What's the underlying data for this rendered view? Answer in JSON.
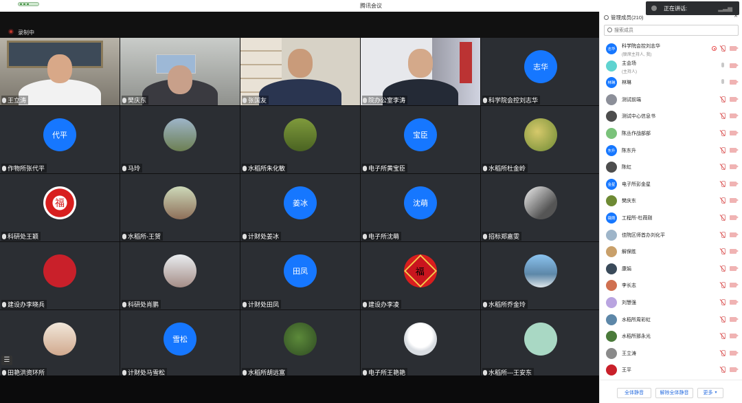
{
  "window": {
    "title": "腾讯会议"
  },
  "speaking_indicator": {
    "label": "正在讲话:"
  },
  "recording": {
    "label": "录制中"
  },
  "grid_menu_icon": "menu-icon",
  "tiles": [
    {
      "name": "王立涛",
      "kind": "video"
    },
    {
      "name": "樊庆东",
      "kind": "video"
    },
    {
      "name": "张国友",
      "kind": "video"
    },
    {
      "name": "院办公室李涛",
      "kind": "video"
    },
    {
      "name": "科学院会控刘志华",
      "kind": "avatar",
      "avatar_text": "志华"
    },
    {
      "name": "作物所张代平",
      "kind": "avatar",
      "avatar_text": "代平"
    },
    {
      "name": "马玲",
      "kind": "image"
    },
    {
      "name": "水稻所朱化敏",
      "kind": "image"
    },
    {
      "name": "电子所黄宝臣",
      "kind": "avatar",
      "avatar_text": "宝臣"
    },
    {
      "name": "水稻所杜金岭",
      "kind": "image"
    },
    {
      "name": "科研处王颖",
      "kind": "image",
      "avatar_text": "福"
    },
    {
      "name": "水稻所-王贺",
      "kind": "image"
    },
    {
      "name": "计财处姜冰",
      "kind": "avatar",
      "avatar_text": "姜冰"
    },
    {
      "name": "电子所沈萌",
      "kind": "avatar",
      "avatar_text": "沈萌"
    },
    {
      "name": "招标郑嘉雯",
      "kind": "image"
    },
    {
      "name": "建设办李晓兵",
      "kind": "image"
    },
    {
      "name": "科研处肖鹏",
      "kind": "image"
    },
    {
      "name": "计财处田凤",
      "kind": "avatar",
      "avatar_text": "田凤"
    },
    {
      "name": "建设办李凌",
      "kind": "image",
      "avatar_text": "福"
    },
    {
      "name": "水稻所乔金玲",
      "kind": "image"
    },
    {
      "name": "田艳洪资环所",
      "kind": "image"
    },
    {
      "name": "计财处马雪松",
      "kind": "avatar",
      "avatar_text": "雪松"
    },
    {
      "name": "水稻所胡远富",
      "kind": "image"
    },
    {
      "name": "电子所王艳艳",
      "kind": "image"
    },
    {
      "name": "水稻所---王安东",
      "kind": "image"
    }
  ],
  "panel": {
    "title": "管理成员(210)",
    "search_placeholder": "搜索成员",
    "members": [
      {
        "name": "科学院会控刘志华",
        "role": "(联席主持人, 我)",
        "avatar_text": "志华",
        "color": "#1677ff",
        "mic": "muted",
        "recording": true
      },
      {
        "name": "主会场",
        "role": "(主持人)",
        "avatar_text": "",
        "color": "#5fd3d0",
        "mic": "on"
      },
      {
        "name": "林琳",
        "role": "",
        "avatar_text": "林琳",
        "color": "#1677ff",
        "mic": "on"
      },
      {
        "name": "测试前端",
        "role": "",
        "avatar_text": "",
        "color": "#8c8f99",
        "mic": "muted"
      },
      {
        "name": "测试中心信息书",
        "role": "",
        "avatar_text": "",
        "color": "#4d4d4d",
        "mic": "muted"
      },
      {
        "name": "陈丛作战部部",
        "role": "",
        "avatar_text": "",
        "color": "#7ac27a",
        "mic": "muted"
      },
      {
        "name": "陈东升",
        "role": "",
        "avatar_text": "东升",
        "color": "#1677ff",
        "mic": "muted"
      },
      {
        "name": "陈虹",
        "role": "",
        "avatar_text": "",
        "color": "#4d4d4d",
        "mic": "muted"
      },
      {
        "name": "电子所彭金星",
        "role": "",
        "avatar_text": "金星",
        "color": "#1677ff",
        "mic": "muted"
      },
      {
        "name": "樊庆东",
        "role": "",
        "avatar_text": "",
        "color": "#6e8a34",
        "mic": "muted"
      },
      {
        "name": "工程所-杜薇刚",
        "role": "",
        "avatar_text": "薇刚",
        "color": "#1677ff",
        "mic": "muted"
      },
      {
        "name": "佳院区师首办刘化平",
        "role": "",
        "avatar_text": "",
        "color": "#9eb5c9",
        "mic": "muted"
      },
      {
        "name": "解保胜",
        "role": "",
        "avatar_text": "",
        "color": "#c9a06a",
        "mic": "muted"
      },
      {
        "name": "康娟",
        "role": "",
        "avatar_text": "",
        "color": "#3a4a5a",
        "mic": "muted"
      },
      {
        "name": "李长志",
        "role": "",
        "avatar_text": "",
        "color": "#d07050",
        "mic": "muted"
      },
      {
        "name": "刘慧强",
        "role": "",
        "avatar_text": "",
        "color": "#b9a4e0",
        "mic": "muted"
      },
      {
        "name": "水稻所周彩虹",
        "role": "",
        "avatar_text": "",
        "color": "#5d87a8",
        "mic": "muted"
      },
      {
        "name": "水稻所那永光",
        "role": "",
        "avatar_text": "",
        "color": "#4a7a3a",
        "mic": "muted"
      },
      {
        "name": "王立涛",
        "role": "",
        "avatar_text": "",
        "color": "#8a8a8a",
        "mic": "muted"
      },
      {
        "name": "王平",
        "role": "",
        "avatar_text": "",
        "color": "#c9202a",
        "mic": "muted"
      }
    ],
    "buttons": {
      "mute_all": "全体静音",
      "unmute_all": "解除全体静音",
      "more": "更多"
    }
  }
}
